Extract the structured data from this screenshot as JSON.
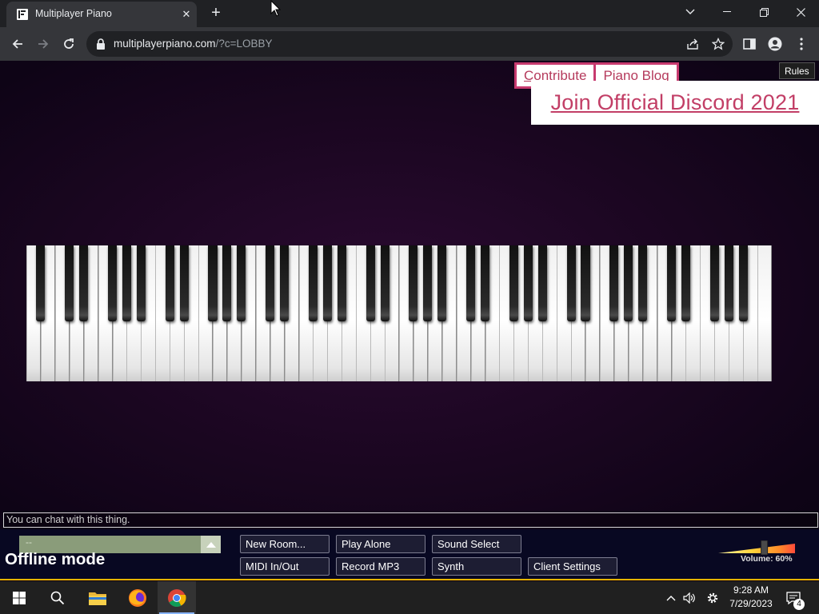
{
  "browser": {
    "tab_title": "Multiplayer Piano",
    "tab_icon": "mpp-favicon-icon",
    "url_host": "multiplayerpiano.com",
    "url_path": "/?c=LOBBY",
    "tooltip": "Rules"
  },
  "page": {
    "links": {
      "contribute": "Contribute",
      "blog": "Piano Blog",
      "discord": "Join Official Discord 2021"
    },
    "piano": {
      "white_key_count": 52,
      "key_colors": {
        "white": "#ffffff",
        "black": "#151515"
      }
    },
    "chat_placeholder": "You can chat with this thing.",
    "room_select_value": "--",
    "status": "Offline mode",
    "buttons": {
      "new_room": "New Room...",
      "play_alone": "Play Alone",
      "sound_select": "Sound Select",
      "midi": "MIDI In/Out",
      "record": "Record MP3",
      "synth": "Synth",
      "client_settings": "Client Settings"
    },
    "volume": {
      "label": "Volume: 60%",
      "value": 0.6
    }
  },
  "taskbar": {
    "time": "9:28 AM",
    "date": "7/29/2023",
    "notifications": "4"
  },
  "colors": {
    "accent_link": "#c23e66",
    "link_border": "#c73a6f",
    "taskbar_accent": "#88b4ff",
    "page_bottom_line": "#e6b400"
  }
}
